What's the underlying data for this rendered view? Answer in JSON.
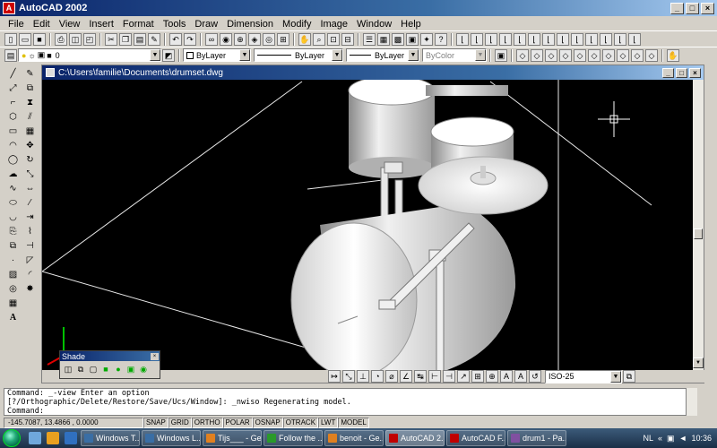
{
  "window": {
    "title": "AutoCAD 2002"
  },
  "menu": [
    "File",
    "Edit",
    "View",
    "Insert",
    "Format",
    "Tools",
    "Draw",
    "Dimension",
    "Modify",
    "Image",
    "Window",
    "Help"
  ],
  "toolbar2": {
    "layer_value": "0",
    "color_value": "ByLayer",
    "linetype_value": "ByLayer",
    "lineweight_value": "ByLayer",
    "plotstyle_value": "ByColor"
  },
  "drawing": {
    "title": "C:\\Users\\familie\\Documents\\drumset.dwg"
  },
  "dim_toolbar": {
    "style_value": "ISO-25"
  },
  "shade_toolbar": {
    "title": "Shade"
  },
  "command": {
    "line1": "Command:  _-view Enter an option",
    "line2": "[?/Orthographic/Delete/Restore/Save/Ucs/Window]: _nwiso Regenerating model.",
    "line3": "Command:"
  },
  "status": {
    "coords": "-145.7087, 13.4866 , 0.0000",
    "buttons": [
      "SNAP",
      "GRID",
      "ORTHO",
      "POLAR",
      "OSNAP",
      "OTRACK",
      "LWT",
      "MODEL"
    ]
  },
  "taskbar": {
    "tasks": [
      {
        "label": "Windows T...",
        "color": "#3a6ea5"
      },
      {
        "label": "Windows L...",
        "color": "#3a6ea5"
      },
      {
        "label": "Tijs___ - Ge...",
        "color": "#e08020"
      },
      {
        "label": "Follow the ...",
        "color": "#2a9a2a"
      },
      {
        "label": "benoit - Ge...",
        "color": "#e08020"
      },
      {
        "label": "AutoCAD 2...",
        "color": "#c00000"
      },
      {
        "label": "AutoCAD F...",
        "color": "#c00000"
      },
      {
        "label": "drum1 - Pa...",
        "color": "#8050a0"
      }
    ],
    "lang": "NL",
    "time": "10:36"
  },
  "colors": {
    "canvas": "#000000",
    "title_blue": "#0a246a"
  }
}
